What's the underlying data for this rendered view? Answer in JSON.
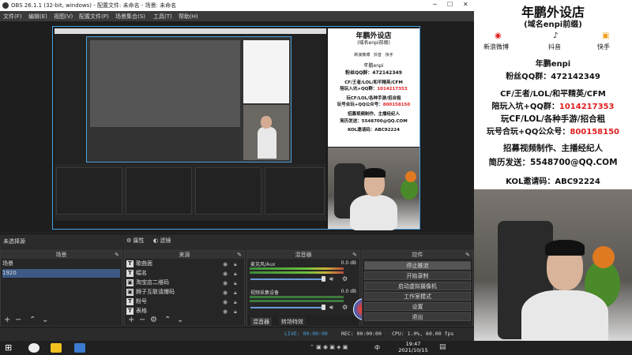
{
  "window": {
    "title": "OBS 26.1.1 (32-bit, windows) - 配置文件: 未命名 - 场景: 未命名"
  },
  "menu": [
    "文件(F)",
    "编辑(E)",
    "视图(V)",
    "配置文件(P)",
    "场景集合(S)",
    "工具(T)",
    "帮助(H)"
  ],
  "ad": {
    "title": "年鹏外设店",
    "subtitle": "(域名enpi前缀)",
    "socials": [
      {
        "label": "新浪微博",
        "icon": "weibo-icon"
      },
      {
        "label": "抖音",
        "icon": "tiktok-icon"
      },
      {
        "label": "快手",
        "icon": "kuaishou-icon"
      }
    ],
    "handle": "年鹏enpi",
    "qq_fans": "粉丝QQ群：472142349",
    "line_games": "CF/王者/LOL/和平精英/CFM",
    "line_team_label": "陪玩入坑+QQ群：",
    "line_team_num": "1014217353",
    "line_play": "玩CF/LOL/各种手游/招合租",
    "line_gzh_label": "玩号合玩+QQ公众号：",
    "line_gzh_num": "800158150",
    "line_recruit": "招募视频制作、主播经纪人",
    "line_resume": "简历发送：5548700@QQ.COM",
    "line_kol": "KOL邀请码：ABC92224"
  },
  "source_bar": {
    "label": "未选择源",
    "props": "属性",
    "filters": "滤镜"
  },
  "scenes": {
    "header": "场景",
    "items": [
      "场景",
      "1920"
    ],
    "selected": 1
  },
  "sources": {
    "header": "来源",
    "items": [
      {
        "icon": "T",
        "label": "歌曲面"
      },
      {
        "icon": "T",
        "label": "幅名"
      },
      {
        "icon": "img",
        "label": "淘宝店二维码"
      },
      {
        "icon": "img",
        "label": "狮子互联请爆码"
      },
      {
        "icon": "T",
        "label": "粉号"
      },
      {
        "icon": "T",
        "label": "表格"
      }
    ]
  },
  "mixer": {
    "header": "混音器",
    "channels": [
      {
        "name": "麦克风/Aux",
        "db": "0.0 dB"
      },
      {
        "name": "视频采集设备",
        "db": "0.0 dB"
      }
    ],
    "tabs": [
      "混音器",
      "转场特效"
    ]
  },
  "controls": {
    "header": "控件",
    "buttons": [
      "停止推流",
      "开始录制",
      "启动虚拟摄像机",
      "工作室模式",
      "设置",
      "退出"
    ]
  },
  "status": {
    "live": "LIVE: 00:00:00",
    "rec": "REC: 00:00:00",
    "cpu": "CPU: 1.0%, 60.00 fps"
  },
  "taskbar": {
    "time": "19:47",
    "date": "2021/10/15",
    "lang": "中"
  },
  "colors": {
    "accent": "#4aa3df",
    "selected": "#3c5a85",
    "highlight": "#e02020"
  }
}
